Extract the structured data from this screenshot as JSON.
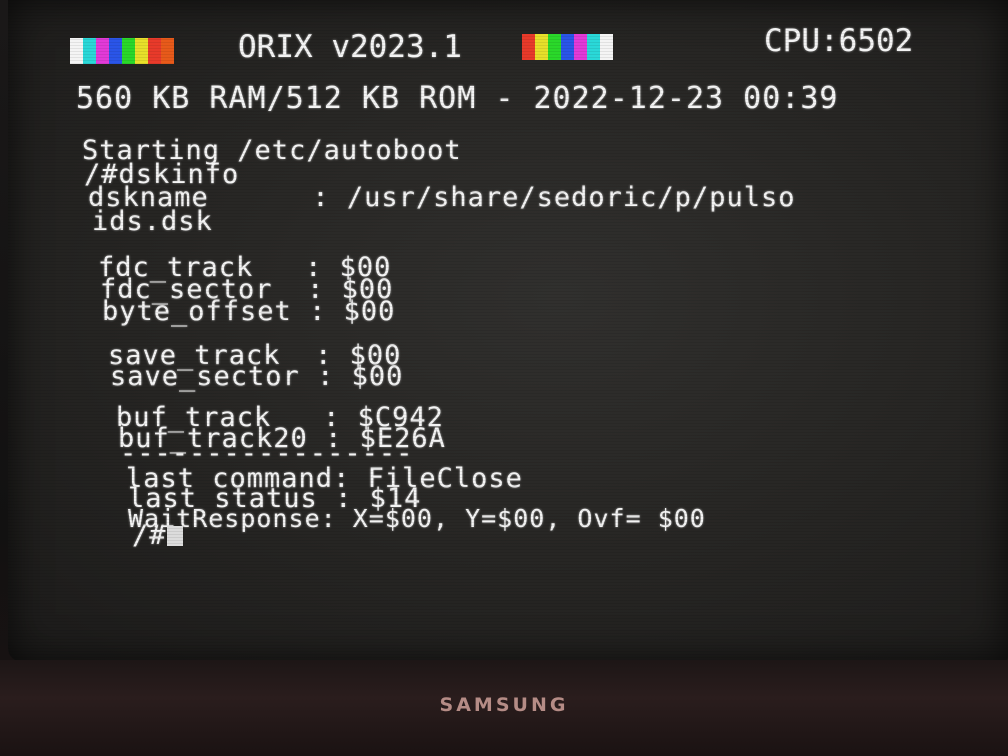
{
  "header": {
    "os_name": "ORIX v2023.1",
    "cpu": "CPU:6502",
    "memory_date": "560 KB RAM/512 KB ROM - 2022-12-23 00:39",
    "color_bar_left": [
      "#f4f4f4",
      "#2ad8d8",
      "#e23ad8",
      "#2a55e8",
      "#2ad82a",
      "#e8e02a",
      "#e83a2a",
      "#e85a1a"
    ],
    "color_bar_right": [
      "#e83a2a",
      "#e8e02a",
      "#2ad82a",
      "#2a55e8",
      "#e23ad8",
      "#2ad8d8",
      "#f4f4f4"
    ]
  },
  "terminal": {
    "boot_line": "Starting /etc/autoboot",
    "command": "/#dskinfo",
    "dskname_line1": "dskname      : /usr/share/sedoric/p/pulso",
    "dskname_line2": "ids.dsk",
    "fdc_track": "fdc_track   : $00",
    "fdc_sector": "fdc_sector  : $00",
    "byte_offset": "byte_offset : $00",
    "save_track": "save_track  : $00",
    "save_sector": "save_sector : $00",
    "buf_track": "buf_track   : $C942",
    "buf_track20": "buf_track20 : $E26A",
    "separator": "-----------------",
    "last_command": "last command: FileClose",
    "last_status": "last status : $14",
    "wait_response": "WaitResponse: X=$00, Y=$00, Ovf= $00",
    "prompt": "/#"
  },
  "monitor": {
    "brand": "SAMSUNG"
  }
}
